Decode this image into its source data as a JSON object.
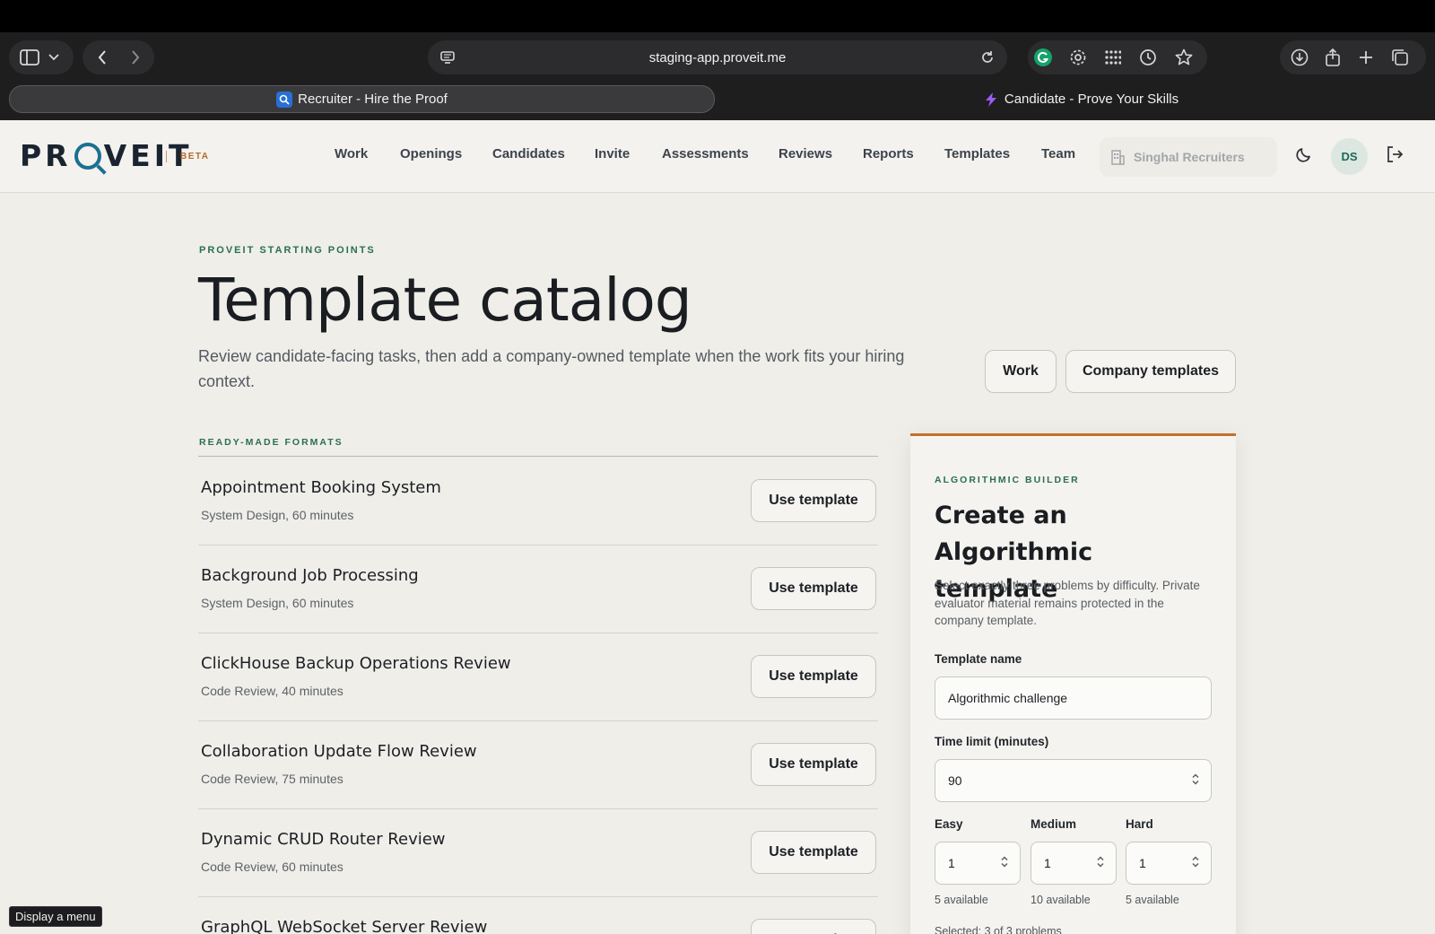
{
  "browser": {
    "url": "staging-app.proveit.me",
    "tabs": [
      {
        "label": "Recruiter - Hire the Proof",
        "active": true
      },
      {
        "label": "Candidate - Prove Your Skills",
        "active": false
      }
    ]
  },
  "header": {
    "logo": {
      "left": "PR",
      "right": "VEIT"
    },
    "beta": "BETA",
    "nav": [
      "Work",
      "Openings",
      "Candidates",
      "Invite",
      "Assessments",
      "Reviews",
      "Reports",
      "Templates",
      "Team"
    ],
    "org": "Singhal Recruiters",
    "avatar": "DS"
  },
  "hero": {
    "eyebrow": "PROVEIT STARTING POINTS",
    "title": "Template catalog",
    "description": "Review candidate-facing tasks, then add a company-owned template when the work fits your hiring context.",
    "work_button": "Work",
    "company_button": "Company templates"
  },
  "catalog": {
    "eyebrow": "READY-MADE FORMATS",
    "use_label": "Use template",
    "items": [
      {
        "title": "Appointment Booking System",
        "meta": "System Design, 60 minutes"
      },
      {
        "title": "Background Job Processing",
        "meta": "System Design, 60 minutes"
      },
      {
        "title": "ClickHouse Backup Operations Review",
        "meta": "Code Review, 40 minutes"
      },
      {
        "title": "Collaboration Update Flow Review",
        "meta": "Code Review, 75 minutes"
      },
      {
        "title": "Dynamic CRUD Router Review",
        "meta": "Code Review, 60 minutes"
      },
      {
        "title": "GraphQL WebSocket Server Review",
        "meta": ""
      }
    ]
  },
  "builder": {
    "eyebrow": "ALGORITHMIC BUILDER",
    "title": "Create an Algorithmic template",
    "description": "Select exactly three problems by difficulty. Private evaluator material remains protected in the company template.",
    "name_label": "Template name",
    "name_value": "Algorithmic challenge",
    "time_label": "Time limit (minutes)",
    "time_value": "90",
    "easy_label": "Easy",
    "easy_value": "1",
    "easy_available": "5 available",
    "medium_label": "Medium",
    "medium_value": "1",
    "medium_available": "10 available",
    "hard_label": "Hard",
    "hard_value": "1",
    "hard_available": "5 available",
    "selected": "Selected: 3 of 3 problems"
  },
  "tooltip": "Display a menu"
}
